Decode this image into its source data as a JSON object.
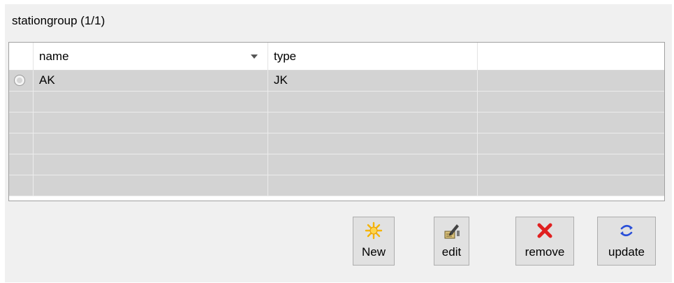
{
  "group_title": "stationgroup (1/1)",
  "table": {
    "columns": [
      "name",
      "type",
      ""
    ],
    "rows": [
      {
        "name": "AK",
        "type": "JK",
        "extra": ""
      },
      {
        "name": "",
        "type": "",
        "extra": ""
      },
      {
        "name": "",
        "type": "",
        "extra": ""
      },
      {
        "name": "",
        "type": "",
        "extra": ""
      },
      {
        "name": "",
        "type": "",
        "extra": ""
      },
      {
        "name": "",
        "type": "",
        "extra": ""
      }
    ]
  },
  "toolbar": {
    "new_label": "New",
    "edit_label": "edit",
    "remove_label": "remove",
    "update_label": "update",
    "icons": {
      "new": "sun-icon",
      "edit": "pencil-icon",
      "remove": "red-x-icon",
      "update": "refresh-icon"
    }
  },
  "colors": {
    "row_bg": "#d3d3d3",
    "panel_bg": "#f0f0f0",
    "remove_icon": "#e02020",
    "update_icon": "#2a4fd8",
    "new_icon": "#f5b400"
  }
}
